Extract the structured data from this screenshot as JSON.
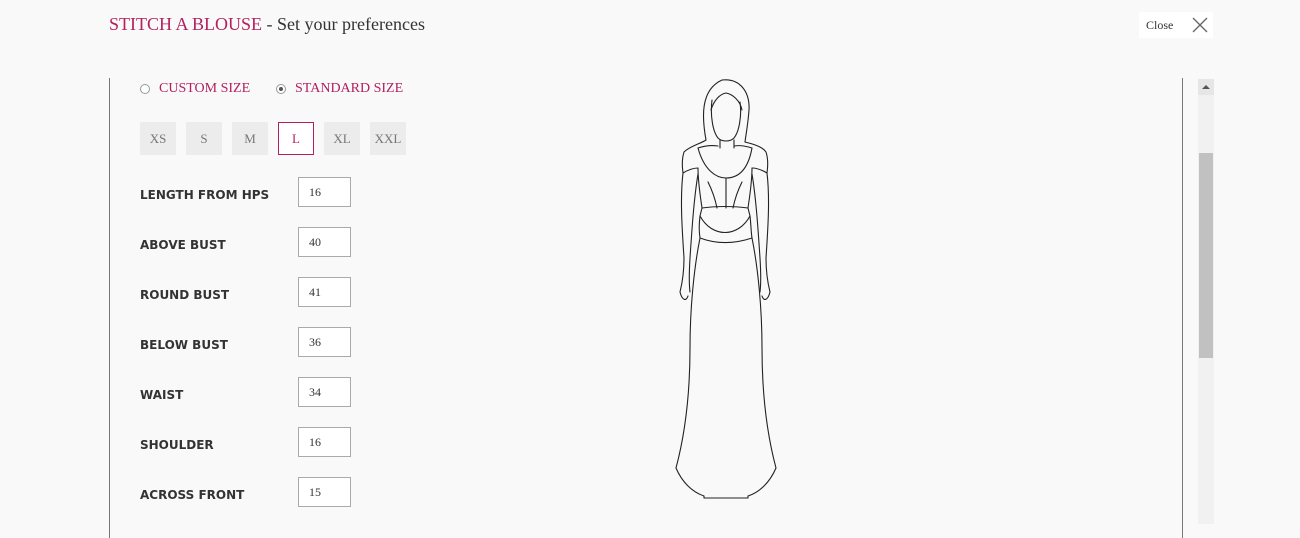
{
  "header": {
    "brand": "STITCH A BLOUSE",
    "separator": " - ",
    "subtitle": "Set your preferences",
    "close_label": "Close",
    "accent_color": "#b3205e"
  },
  "size_mode": {
    "options": [
      {
        "label": "CUSTOM SIZE",
        "checked": false
      },
      {
        "label": "STANDARD SIZE",
        "checked": true
      }
    ]
  },
  "sizes": {
    "options": [
      "XS",
      "S",
      "M",
      "L",
      "XL",
      "XXL"
    ],
    "selected": "L"
  },
  "measurements": [
    {
      "label": "LENGTH FROM HPS",
      "value": "16"
    },
    {
      "label": "ABOVE BUST",
      "value": "40"
    },
    {
      "label": "ROUND BUST",
      "value": "41"
    },
    {
      "label": "BELOW BUST",
      "value": "36"
    },
    {
      "label": "WAIST",
      "value": "34"
    },
    {
      "label": "SHOULDER",
      "value": "16"
    },
    {
      "label": "ACROSS FRONT",
      "value": "15"
    }
  ]
}
